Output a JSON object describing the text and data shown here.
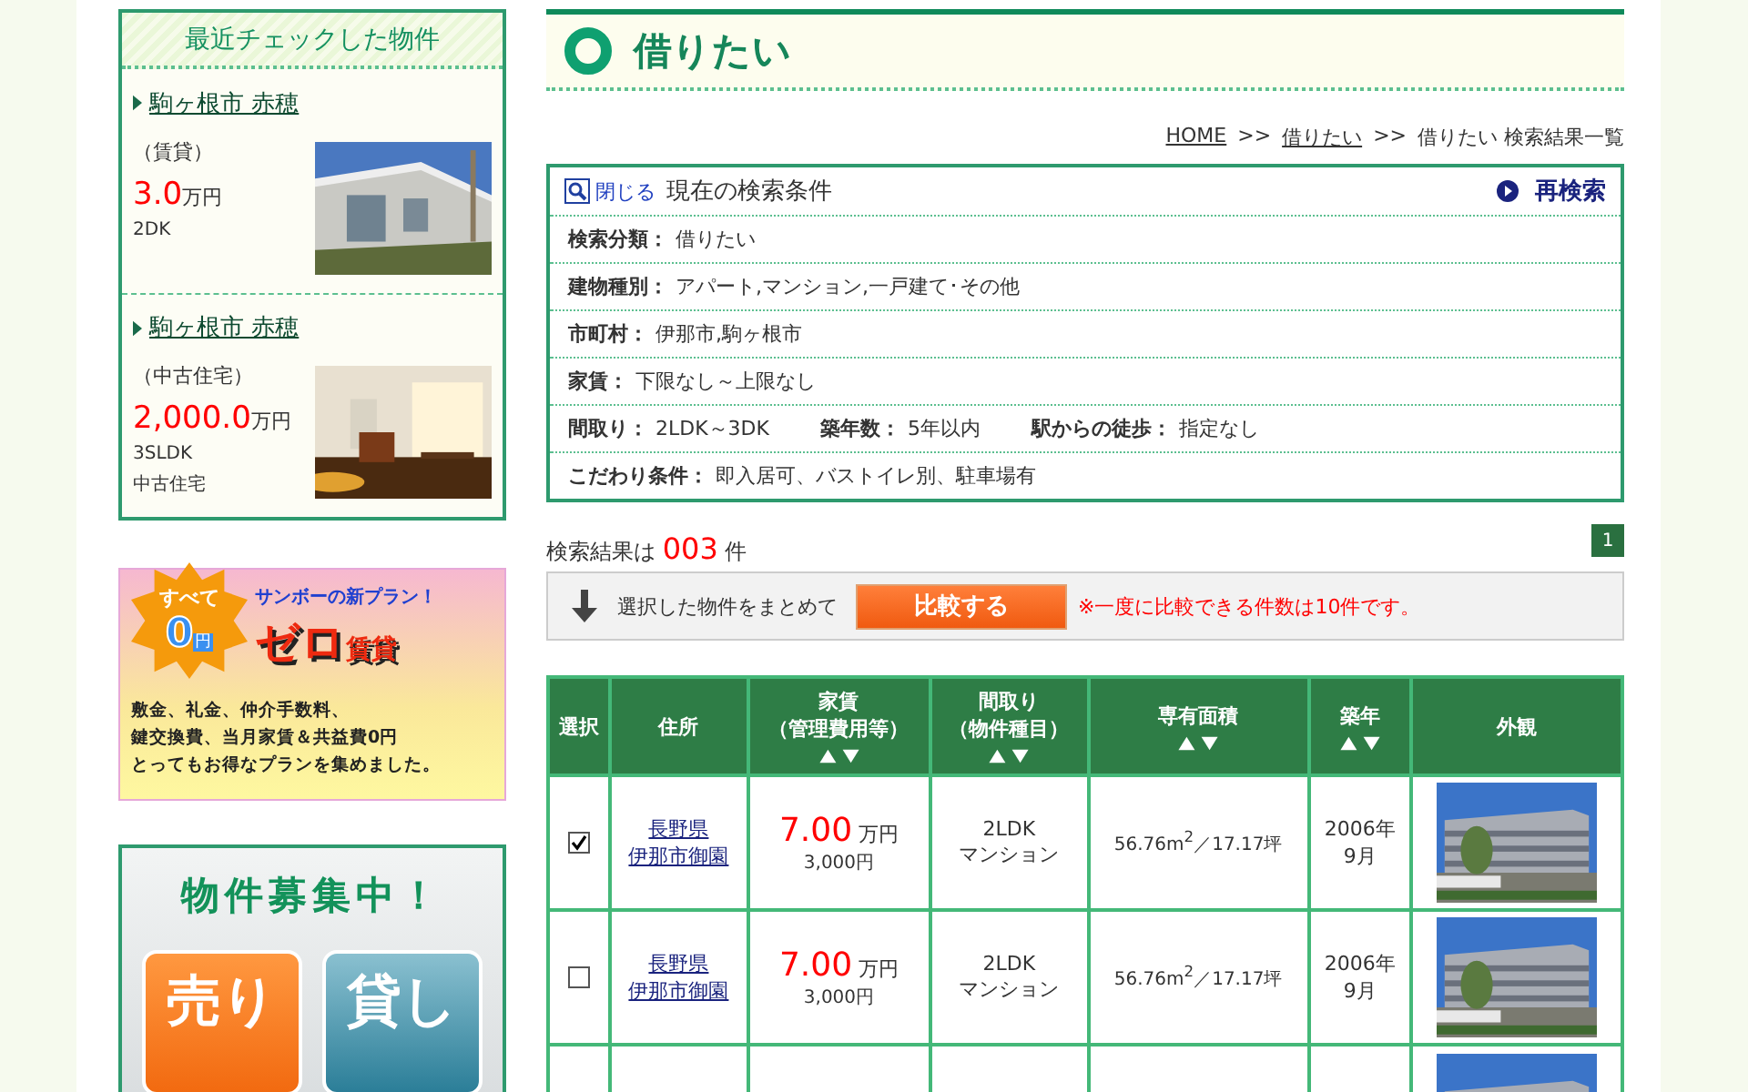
{
  "sidebar": {
    "recent": {
      "title": "最近チェックした物件",
      "items": [
        {
          "location": "駒ヶ根市 赤穂",
          "category": "（賃貸）",
          "price": "3.0",
          "unit": "万円",
          "layout": "2DK"
        },
        {
          "location": "駒ヶ根市 赤穂",
          "category": "（中古住宅）",
          "price": "2,000.0",
          "unit": "万円",
          "layout": "3SLDK",
          "note": "中古住宅"
        }
      ]
    },
    "zero_banner": {
      "badge_top": "すべて",
      "badge_num": "0",
      "badge_unit": "円",
      "tagline": "サンボーの新プラン！",
      "headline": "ゼロ",
      "headline_small": "賃貸",
      "lines": [
        "敷金、礼金、仲介手数料、",
        "鍵交換費、当月家賃＆共益費0円",
        "とってもお得なプランを集めました。"
      ]
    },
    "recruit_banner": {
      "title": "物件募集中！",
      "buttons": [
        "売り",
        "貸し"
      ]
    }
  },
  "main": {
    "title": "借りたい",
    "breadcrumb": [
      {
        "text": "HOME",
        "link": true
      },
      {
        "text": ">>",
        "link": false
      },
      {
        "text": "借りたい",
        "link": true
      },
      {
        "text": ">>",
        "link": false
      },
      {
        "text": "借りたい 検索結果一覧",
        "link": false
      }
    ],
    "conditions": {
      "toggle": "閉じる",
      "title": "現在の検索条件",
      "research": "再検索",
      "rows": [
        [
          {
            "label": "検索分類：",
            "value": "借りたい"
          }
        ],
        [
          {
            "label": "建物種別：",
            "value": "アパート,マンション,一戸建て･その他"
          }
        ],
        [
          {
            "label": "市町村：",
            "value": "伊那市,駒ヶ根市"
          }
        ],
        [
          {
            "label": "家賃：",
            "value": "下限なし～上限なし"
          }
        ],
        [
          {
            "label": "間取り：",
            "value": "2LDK～3DK"
          },
          {
            "label": "築年数：",
            "value": "5年以内"
          },
          {
            "label": "駅からの徒歩：",
            "value": "指定なし"
          }
        ],
        [
          {
            "label": "こだわり条件：",
            "value": "即入居可、バストイレ別、駐車場有"
          }
        ]
      ]
    },
    "results": {
      "prefix": "検索結果は",
      "count": "003",
      "suffix": "件",
      "pages": [
        {
          "label": "1",
          "selected": true
        }
      ]
    },
    "compare": {
      "text": "選択した物件をまとめて",
      "button": "比較する",
      "note": "※一度に比較できる件数は10件です。"
    },
    "table": {
      "columns": [
        {
          "lines": [
            "選択"
          ],
          "sortable": false
        },
        {
          "lines": [
            "住所"
          ],
          "sortable": false
        },
        {
          "lines": [
            "家賃",
            "（管理費用等）"
          ],
          "sortable": true
        },
        {
          "lines": [
            "間取り",
            "（物件種目）"
          ],
          "sortable": true
        },
        {
          "lines": [
            "専有面積"
          ],
          "sortable": true
        },
        {
          "lines": [
            "築年"
          ],
          "sortable": true
        },
        {
          "lines": [
            "外観"
          ],
          "sortable": false
        }
      ],
      "rows": [
        {
          "checked": true,
          "address": [
            "長野県",
            "伊那市御園"
          ],
          "rent": "7.00",
          "rent_unit": "万円",
          "fee": "3,000円",
          "layout": "2LDK",
          "type": "マンション",
          "area": "56.76m$^{2}$／17.17坪",
          "built": [
            "2006年",
            "9月"
          ]
        },
        {
          "checked": false,
          "address": [
            "長野県",
            "伊那市御園"
          ],
          "rent": "7.00",
          "rent_unit": "万円",
          "fee": "3,000円",
          "layout": "2LDK",
          "type": "マンション",
          "area": "56.76m$^{2}$／17.17坪",
          "built": [
            "2006年",
            "9月"
          ]
        },
        {
          "kind": "partial"
        }
      ]
    }
  }
}
